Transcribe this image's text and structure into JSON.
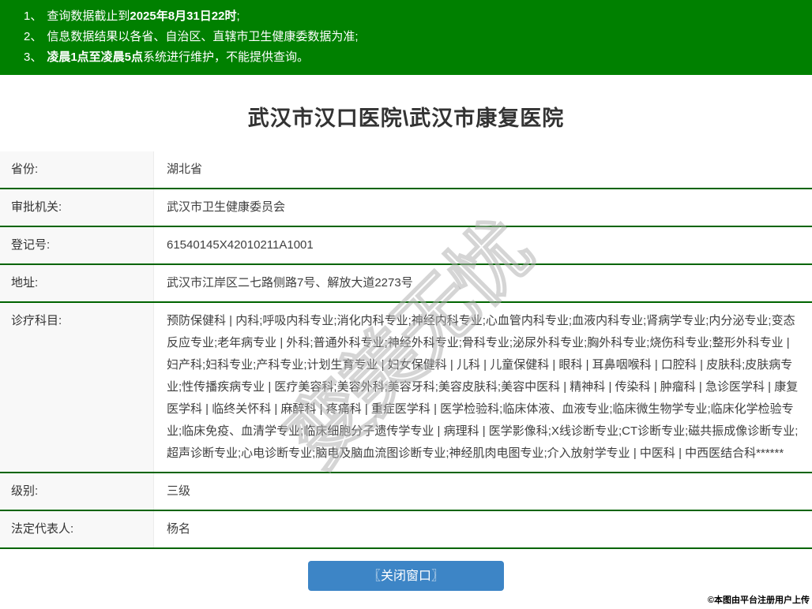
{
  "notices": [
    {
      "num": "1、",
      "pre": "查询数据截止到",
      "bold": "2025年8月31日22时",
      "post": ";"
    },
    {
      "num": "2、",
      "pre": "信息数据结果以各省、自治区、直辖市卫生健康委数据为准;",
      "bold": "",
      "post": ""
    },
    {
      "num": "3、",
      "pre": "",
      "bold": "凌晨1点至凌晨5点",
      "post": "系统进行维护，不能提供查询。"
    }
  ],
  "page": {
    "title": "武汉市汉口医院\\武汉市康复医院"
  },
  "table": {
    "rows": [
      {
        "label": "省份:",
        "value": "湖北省"
      },
      {
        "label": "审批机关:",
        "value": "武汉市卫生健康委员会"
      },
      {
        "label": "登记号:",
        "value": "61540145X42010211A1001"
      },
      {
        "label": "地址:",
        "value": "武汉市江岸区二七路侧路7号、解放大道2273号"
      },
      {
        "label": "诊疗科目:",
        "value": "预防保健科 | 内科;呼吸内科专业;消化内科专业;神经内科专业;心血管内科专业;血液内科专业;肾病学专业;内分泌专业;变态反应专业;老年病专业 | 外科;普通外科专业;神经外科专业;骨科专业;泌尿外科专业;胸外科专业;烧伤科专业;整形外科专业 | 妇产科;妇科专业;产科专业;计划生育专业 | 妇女保健科 | 儿科 | 儿童保健科 | 眼科 | 耳鼻咽喉科 | 口腔科 | 皮肤科;皮肤病专业;性传播疾病专业 | 医疗美容科;美容外科;美容牙科;美容皮肤科;美容中医科 | 精神科 | 传染科 | 肿瘤科 | 急诊医学科 | 康复医学科 | 临终关怀科 | 麻醉科 | 疼痛科 | 重症医学科 | 医学检验科;临床体液、血液专业;临床微生物学专业;临床化学检验专业;临床免疫、血清学专业;临床细胞分子遗传学专业 | 病理科 | 医学影像科;X线诊断专业;CT诊断专业;磁共振成像诊断专业;超声诊断专业;心电诊断专业;脑电及脑血流图诊断专业;神经肌肉电图专业;介入放射学专业 | 中医科 | 中西医结合科******"
      },
      {
        "label": "级别:",
        "value": "三级"
      },
      {
        "label": "法定代表人:",
        "value": "杨名"
      }
    ]
  },
  "close_button": {
    "label": "〖关闭窗口〗"
  },
  "watermark": {
    "text": "变美无忧"
  },
  "footer": {
    "credit": "©本图由平台注册用户上传"
  },
  "colors": {
    "header_bg": "#008000",
    "divider": "#006400",
    "button_bg": "#3d85c6",
    "label_bg": "#f8f8f8"
  }
}
